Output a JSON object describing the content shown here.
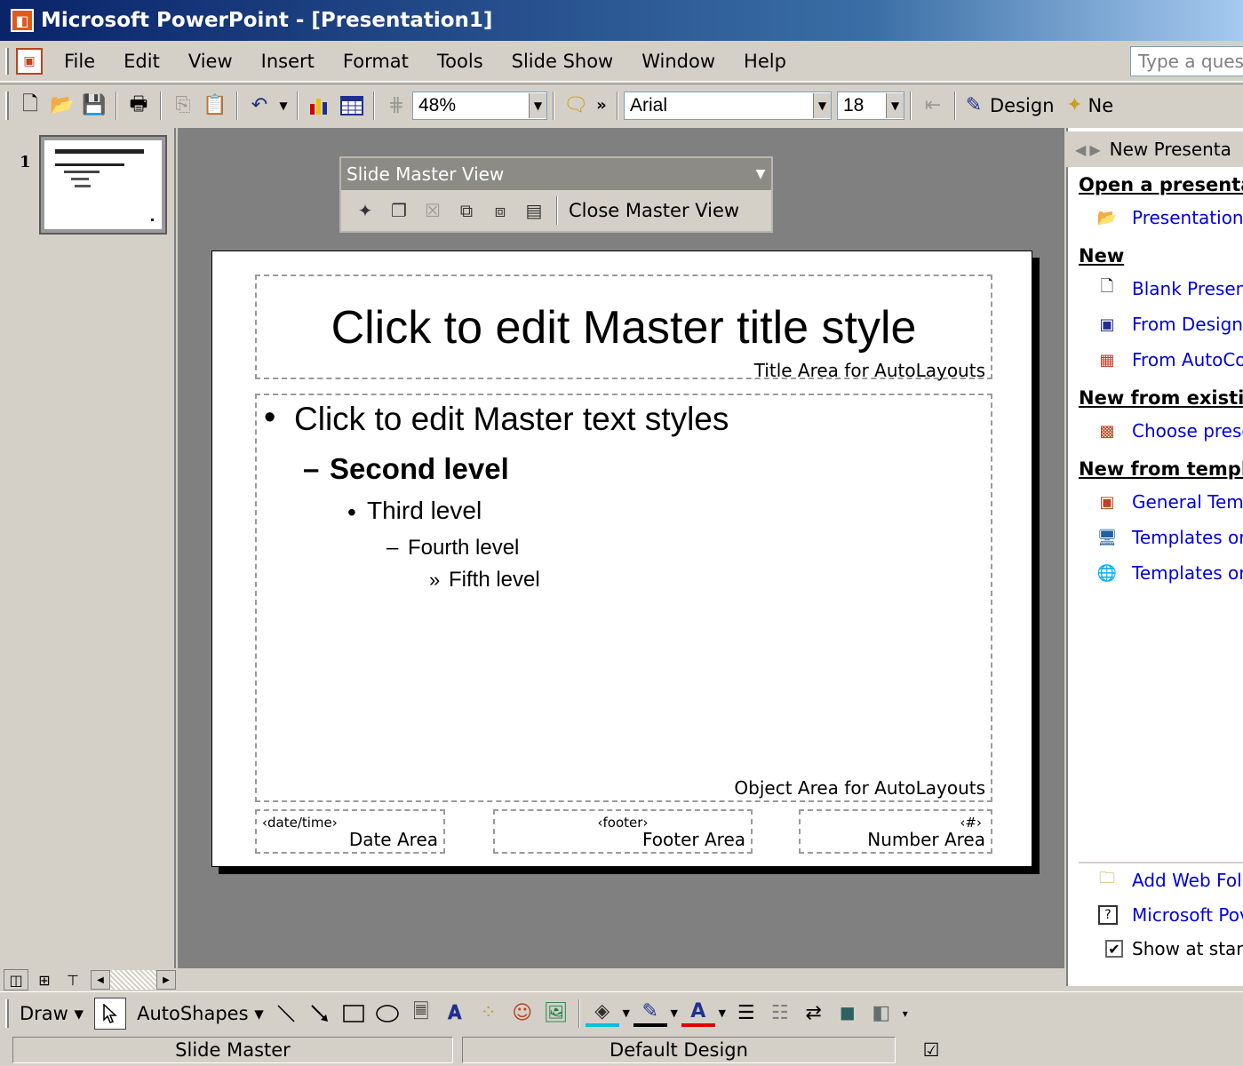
{
  "window": {
    "title": "Microsoft PowerPoint - [Presentation1]",
    "app_icon": "powerpoint-icon"
  },
  "menubar": {
    "items": [
      "File",
      "Edit",
      "View",
      "Insert",
      "Format",
      "Tools",
      "Slide Show",
      "Window",
      "Help"
    ],
    "help_placeholder": "Type a ques"
  },
  "toolbar": {
    "zoom": "48%",
    "font": "Arial",
    "font_size": "18",
    "more": "»",
    "design_label": "Design",
    "new_slide_label": "Ne"
  },
  "slides_pane": {
    "slide_number": "1"
  },
  "slide_master_toolbar": {
    "title": "Slide Master View",
    "close_label": "Close Master View"
  },
  "slide": {
    "title": "Click to edit Master title style",
    "title_area_label": "Title Area for AutoLayouts",
    "level1": "Click to edit Master text styles",
    "level2": "Second level",
    "level3": "Third level",
    "level4": "Fourth level",
    "level5": "Fifth level",
    "bullet1": "•",
    "bullet2": "–",
    "bullet3": "•",
    "bullet4": "–",
    "bullet5": "»",
    "object_area_label": "Object Area for AutoLayouts",
    "date_tag": "‹date/time›",
    "date_label": "Date Area",
    "footer_tag": "‹footer›",
    "footer_label": "Footer Area",
    "number_tag": "‹#›",
    "number_label": "Number Area"
  },
  "task_pane": {
    "title": "New Presenta",
    "sections": [
      {
        "heading": "Open a presenta",
        "items": [
          {
            "label": "Presentation",
            "icon": "open-folder-icon"
          }
        ]
      },
      {
        "heading": "New",
        "items": [
          {
            "label": "Blank Presen",
            "icon": "blank-document-icon"
          },
          {
            "label": "From Design",
            "icon": "design-template-icon"
          },
          {
            "label": "From AutoCo",
            "icon": "autocontent-icon"
          }
        ]
      },
      {
        "heading": "New from existin",
        "items": [
          {
            "label": "Choose prese",
            "icon": "choose-presentation-icon"
          }
        ]
      },
      {
        "heading": "New from templa",
        "items": [
          {
            "label": "General Temp",
            "icon": "general-templates-icon"
          },
          {
            "label": "Templates or",
            "icon": "templates-my-websites-icon"
          },
          {
            "label": "Templates or",
            "icon": "templates-microsoft-com-icon"
          }
        ]
      }
    ],
    "bottom_links": [
      {
        "label": "Add Web Fol",
        "icon": "add-web-folder-icon"
      },
      {
        "label": "Microsoft Pov",
        "icon": "help-icon"
      }
    ],
    "show_at_startup": "Show at star",
    "show_at_startup_checked": true
  },
  "drawing_toolbar": {
    "draw_label": "Draw",
    "autoshapes_label": "AutoShapes"
  },
  "statusbar": {
    "view": "Slide Master",
    "design": "Default Design"
  }
}
